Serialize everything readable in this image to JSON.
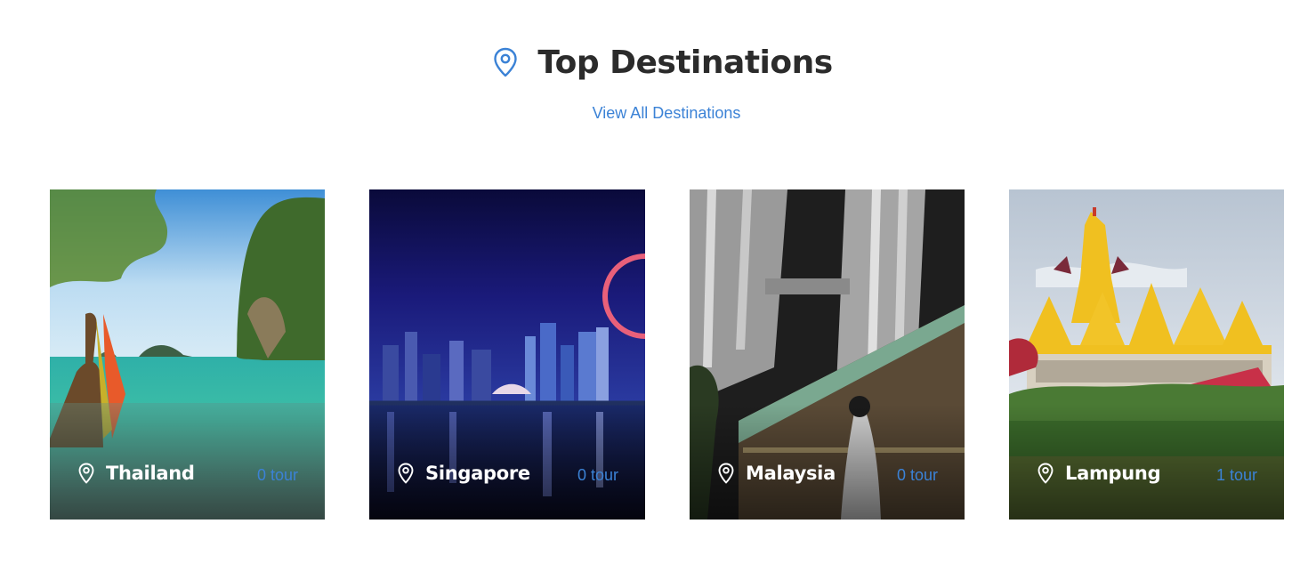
{
  "header": {
    "icon": "map-pin-icon",
    "title": "Top Destinations",
    "view_all_label": "View All Destinations"
  },
  "colors": {
    "accent": "#3b82d6",
    "title": "#2b2b2b",
    "card_text": "#ffffff"
  },
  "destinations": [
    {
      "name": "Thailand",
      "tours": "0 tour",
      "icon": "map-pin-icon"
    },
    {
      "name": "Singapore",
      "tours": "0 tour",
      "icon": "map-pin-icon"
    },
    {
      "name": "Malaysia",
      "tours": "0 tour",
      "icon": "map-pin-icon"
    },
    {
      "name": "Lampung",
      "tours": "1 tour",
      "icon": "map-pin-icon"
    }
  ]
}
